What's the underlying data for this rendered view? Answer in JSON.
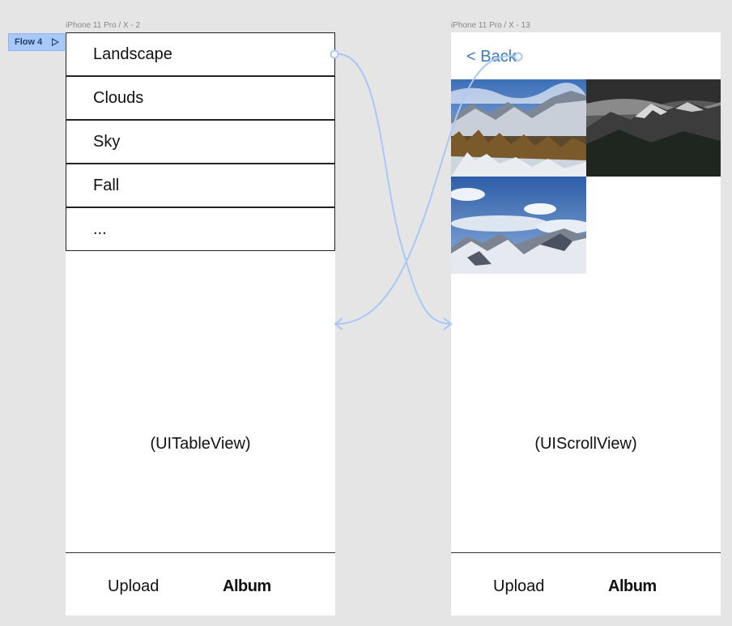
{
  "frames": {
    "left_title": "iPhone 11 Pro / X - 2",
    "right_title": "iPhone 11 Pro / X - 13"
  },
  "flow": {
    "label": "Flow 4",
    "icon": "play-icon"
  },
  "table": {
    "rows": [
      "Landscape",
      "Clouds",
      "Sky",
      "Fall",
      "..."
    ],
    "caption": "(UITableView)"
  },
  "detail": {
    "back_label": "< Back",
    "caption": "(UIScrollView)",
    "photos": [
      "mountain-forest-photo",
      "dark-mountain-photo",
      "snowy-peaks-photo"
    ]
  },
  "tabbar": {
    "upload": "Upload",
    "album": "Album"
  },
  "colors": {
    "connector": "#a8c8f8",
    "flow_tag": "#a8c8f8",
    "back_link": "#3b7bbf"
  }
}
